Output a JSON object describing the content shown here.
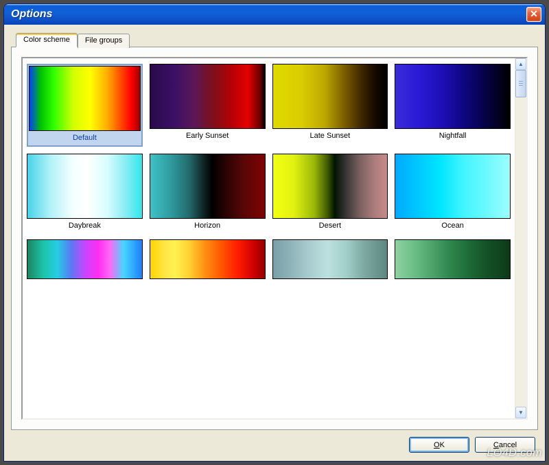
{
  "window": {
    "title": "Options"
  },
  "tabs": [
    {
      "label": "Color scheme",
      "active": true
    },
    {
      "label": "File groups",
      "active": false
    }
  ],
  "schemes": [
    {
      "name": "Default",
      "gradient_class": "g-default",
      "selected": true
    },
    {
      "name": "Early Sunset",
      "gradient_class": "g-early-sunset",
      "selected": false
    },
    {
      "name": "Late Sunset",
      "gradient_class": "g-late-sunset",
      "selected": false
    },
    {
      "name": "Nightfall",
      "gradient_class": "g-nightfall",
      "selected": false
    },
    {
      "name": "Daybreak",
      "gradient_class": "g-daybreak",
      "selected": false
    },
    {
      "name": "Horizon",
      "gradient_class": "g-horizon",
      "selected": false
    },
    {
      "name": "Desert",
      "gradient_class": "g-desert",
      "selected": false
    },
    {
      "name": "Ocean",
      "gradient_class": "g-ocean",
      "selected": false
    },
    {
      "name": "",
      "gradient_class": "g-neon",
      "selected": false
    },
    {
      "name": "",
      "gradient_class": "g-flame",
      "selected": false
    },
    {
      "name": "",
      "gradient_class": "g-steel",
      "selected": false
    },
    {
      "name": "",
      "gradient_class": "g-forest",
      "selected": false
    }
  ],
  "buttons": {
    "ok": {
      "hotkey": "O",
      "rest": "K"
    },
    "cancel": {
      "hotkey": "C",
      "rest": "ancel"
    }
  },
  "watermark": "LO4D.com"
}
